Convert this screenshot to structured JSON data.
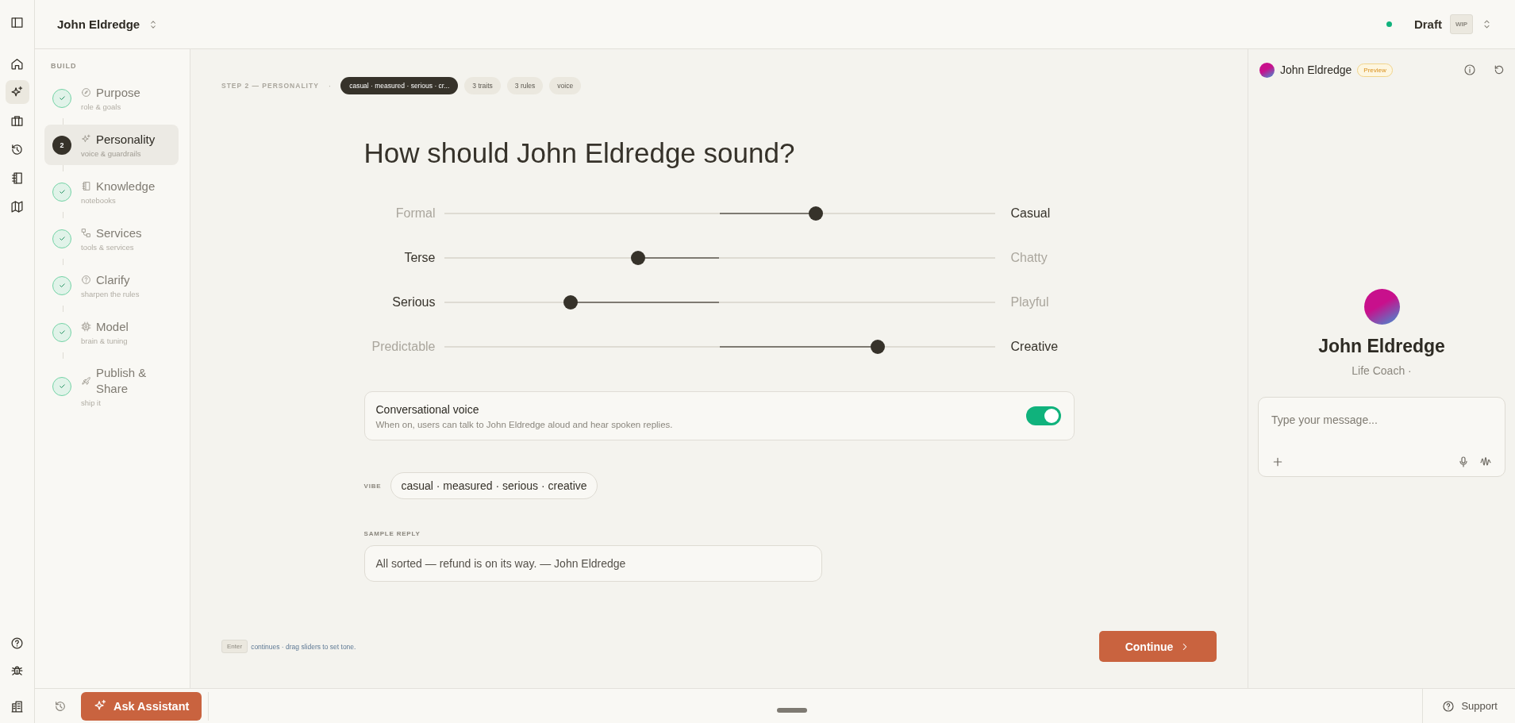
{
  "workspace": {
    "name": "John Eldredge"
  },
  "status": {
    "label": "Draft",
    "badge": "WIP"
  },
  "rail_items": [
    {
      "selected": false
    },
    {
      "selected": true
    },
    {
      "selected": false
    },
    {
      "selected": false
    },
    {
      "selected": false
    },
    {
      "selected": false
    }
  ],
  "sidebar": {
    "section": "BUILD",
    "steps": [
      {
        "title": "Purpose",
        "subtitle": "role & goals",
        "completed": true,
        "selected": false
      },
      {
        "title": "Personality",
        "subtitle": "voice & guardrails",
        "completed": false,
        "number": "2",
        "selected": true
      },
      {
        "title": "Knowledge",
        "subtitle": "notebooks",
        "completed": true,
        "selected": false
      },
      {
        "title": "Services",
        "subtitle": "tools & services",
        "completed": true,
        "selected": false
      },
      {
        "title": "Clarify",
        "subtitle": "sharpen the rules",
        "completed": true,
        "selected": false
      },
      {
        "title": "Model",
        "subtitle": "brain & tuning",
        "completed": true,
        "selected": false
      },
      {
        "title": "Publish & Share",
        "subtitle": "ship it",
        "completed": true,
        "selected": false
      }
    ]
  },
  "step_header": {
    "label": "STEP 2 — PERSONALITY",
    "separator": "·",
    "chips": [
      {
        "text": "casual · measured · serious · cr...",
        "selected": true
      },
      {
        "text": "3 traits",
        "selected": false
      },
      {
        "text": "3 rules",
        "selected": false
      },
      {
        "text": "voice",
        "selected": false
      }
    ]
  },
  "heading": "How should John Eldredge sound?",
  "sliders": [
    {
      "left": "Formal",
      "right": "Casual",
      "level": 0.675
    },
    {
      "left": "Terse",
      "right": "Chatty",
      "level": 0.353
    },
    {
      "left": "Serious",
      "right": "Playful",
      "level": 0.23
    },
    {
      "left": "Predictable",
      "right": "Creative",
      "level": 0.788
    }
  ],
  "voice": {
    "title": "Conversational voice",
    "description": "When on, users can talk to John Eldredge aloud and hear spoken replies.",
    "on": true
  },
  "vibe": {
    "label": "VIBE",
    "value": "casual · measured · serious · creative"
  },
  "sample_reply": {
    "label": "SAMPLE REPLY",
    "text": "All sorted — refund is on its way. — John Eldredge"
  },
  "footer": {
    "key": "Enter",
    "hint": "continues · drag sliders to set tone.",
    "button": "Continue"
  },
  "preview": {
    "name": "John Eldredge",
    "badge": "Preview",
    "title": "John Eldredge",
    "subtitle": "Life Coach ·",
    "placeholder": "Type your message..."
  },
  "bottom_bar": {
    "assistant_button": "Ask Assistant",
    "support": "Support"
  }
}
